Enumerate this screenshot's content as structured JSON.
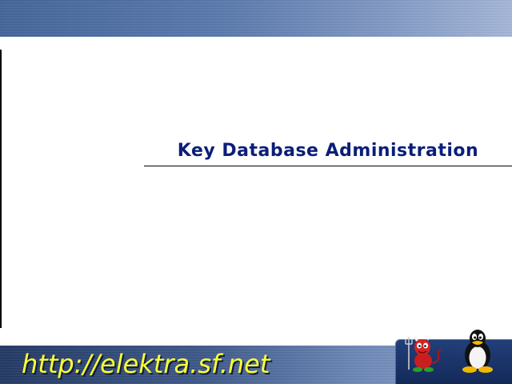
{
  "slide": {
    "title": "Key Database Administration",
    "url": "http://elektra.sf.net"
  },
  "colors": {
    "title": "#0b1e78",
    "url": "#ffff33",
    "bar": "#5878ad"
  },
  "icons": {
    "logo_left": "bsd-daemon-icon",
    "logo_right": "tux-penguin-icon"
  }
}
